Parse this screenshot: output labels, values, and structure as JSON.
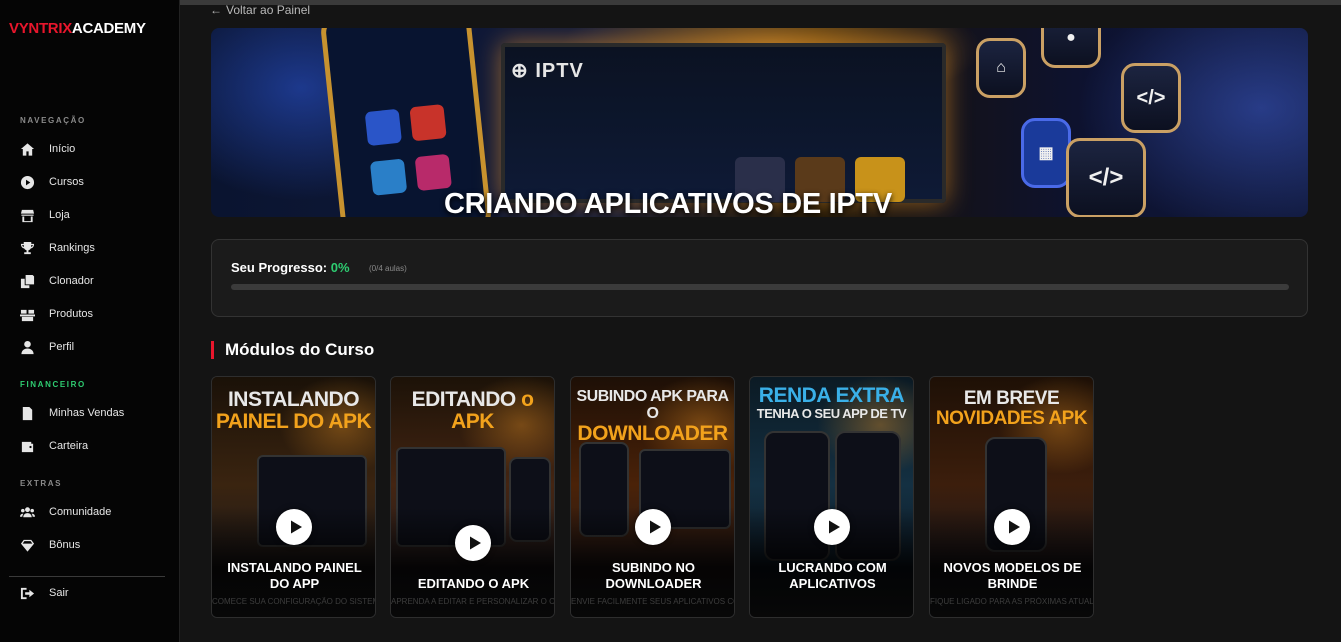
{
  "sidebar": {
    "logo_red": "VYNTRIX",
    "logo_white": "ACADEMY",
    "sections": [
      {
        "label": "NAVEGAÇÃO",
        "items": [
          {
            "label": "Início",
            "icon": "home-icon"
          },
          {
            "label": "Cursos",
            "icon": "play-circle-icon"
          },
          {
            "label": "Loja",
            "icon": "store-icon"
          },
          {
            "label": "Rankings",
            "icon": "trophy-icon"
          },
          {
            "label": "Clonador",
            "icon": "copy-icon"
          },
          {
            "label": "Produtos",
            "icon": "boxes-icon"
          },
          {
            "label": "Perfil",
            "icon": "user-icon"
          }
        ]
      },
      {
        "label": "FINANCEIRO",
        "items": [
          {
            "label": "Minhas Vendas",
            "icon": "receipt-icon"
          },
          {
            "label": "Carteira",
            "icon": "wallet-icon"
          }
        ]
      },
      {
        "label": "EXTRAS",
        "items": [
          {
            "label": "Comunidade",
            "icon": "users-icon"
          },
          {
            "label": "Bônus",
            "icon": "gem-icon"
          }
        ]
      }
    ],
    "logout": {
      "label": "Sair",
      "icon": "logout-icon"
    }
  },
  "main": {
    "back_link": "Voltar ao Painel",
    "banner": {
      "title": "CRIANDO APLICATIVOS DE IPTV",
      "tv_logo": "IPTV"
    },
    "progress": {
      "label": "Seu Progresso:",
      "percent_text": "0%",
      "percent": 0,
      "lessons": "(0/4 aulas)"
    },
    "modules_heading": "Módulos do Curso",
    "modules": [
      {
        "art_line1": "INSTALANDO",
        "art_line2": "PAINEL DO APK",
        "title": "INSTALANDO PAINEL DO APP",
        "description": "COMECE SUA CONFIGURAÇÃO DO SISTEMA",
        "palette": [
          "#1a1108",
          "#3a2410",
          "#0e1420"
        ]
      },
      {
        "art_line1": "EDITANDO",
        "art_line2": "o APK",
        "title": "EDITANDO O APK",
        "description": "APRENDA A EDITAR E PERSONALIZAR O CÓDIGO",
        "palette": [
          "#1c1208",
          "#442512",
          "#0f1626"
        ]
      },
      {
        "art_line1": "SUBINDO APK PARA O",
        "art_line2": "DOWNLOADER",
        "title": "SUBINDO NO DOWNLOADER",
        "description": "ENVIE FACILMENTE SEUS APLICATIVOS COM UM",
        "palette": [
          "#1d0f06",
          "#4a2208",
          "#101420"
        ]
      },
      {
        "art_line1": "RENDA EXTRA",
        "art_line2": "TENHA O SEU APP DE TV",
        "title": "LUCRANDO COM APLICATIVOS",
        "description": "",
        "palette": [
          "#0b1a24",
          "#143042",
          "#0a0f18"
        ]
      },
      {
        "art_line1": "EM BREVE",
        "art_line2": "NOVIDADES APK",
        "title": "NOVOS MODELOS DE BRINDE",
        "description": "FIQUE LIGADO PARA AS PRÓXIMAS ATUALIZAÇÕES",
        "palette": [
          "#1e1006",
          "#3c1e0c",
          "#0c1626"
        ]
      }
    ]
  }
}
